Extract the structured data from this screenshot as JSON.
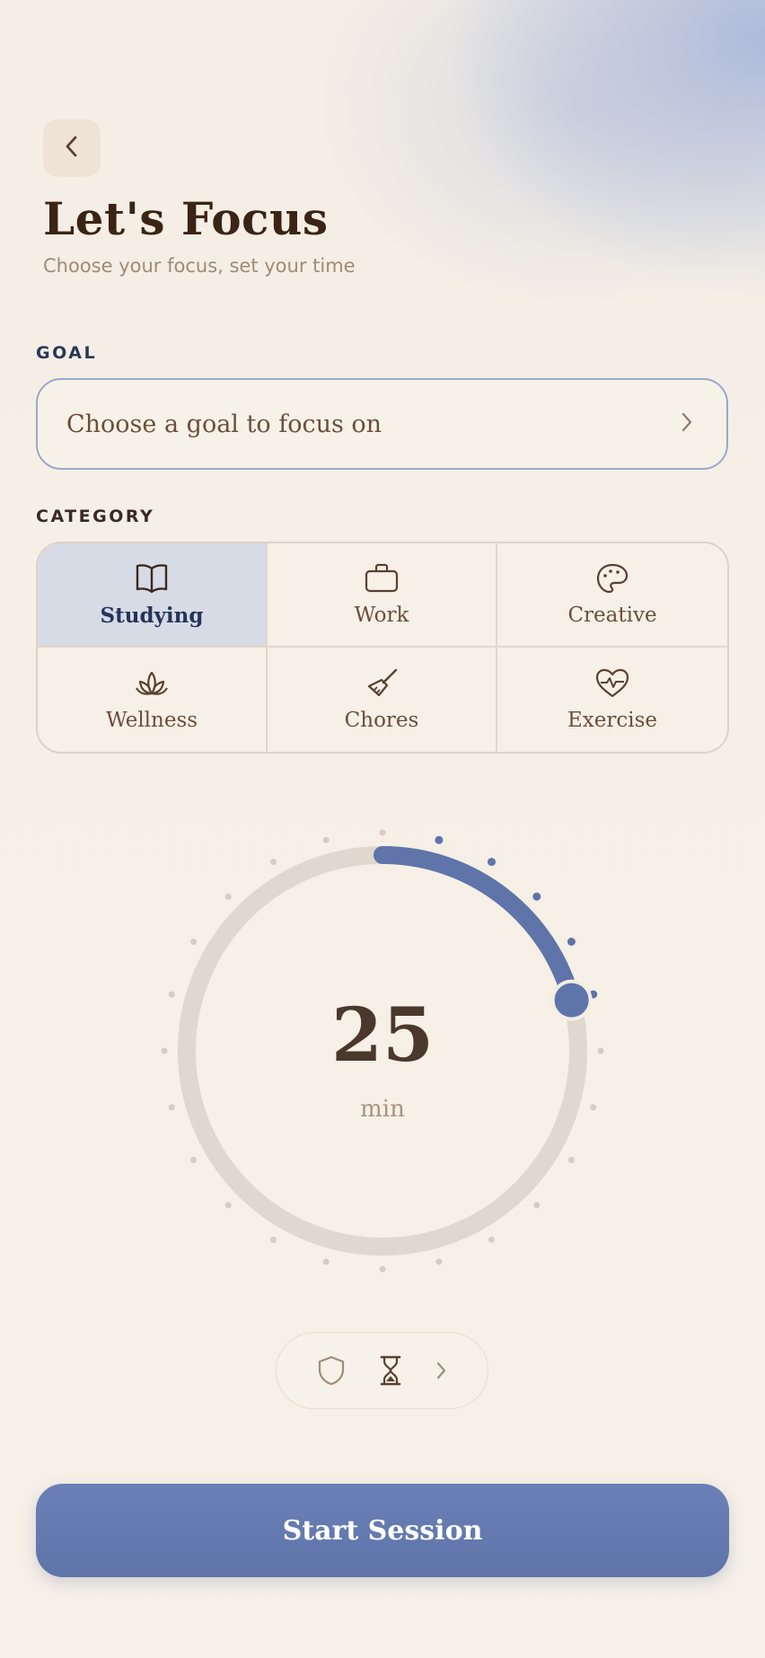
{
  "header": {
    "back_icon": "chevron-left-icon",
    "title": "Let's Focus",
    "subtitle": "Choose your focus, set your time"
  },
  "goal": {
    "section_label": "GOAL",
    "placeholder": "Choose a goal to focus on",
    "chevron_icon": "chevron-right-icon"
  },
  "category": {
    "section_label": "CATEGORY",
    "selected": "Studying",
    "items": [
      {
        "label": "Studying",
        "icon": "book-icon"
      },
      {
        "label": "Work",
        "icon": "briefcase-icon"
      },
      {
        "label": "Creative",
        "icon": "palette-icon"
      },
      {
        "label": "Wellness",
        "icon": "lotus-icon"
      },
      {
        "label": "Chores",
        "icon": "broom-icon"
      },
      {
        "label": "Exercise",
        "icon": "heart-pulse-icon"
      }
    ]
  },
  "timer": {
    "value": "25",
    "unit": "min",
    "minutes": 25,
    "max_minutes": 120,
    "tick_count": 24
  },
  "toolbar": {
    "icons": [
      "shield-icon",
      "hourglass-icon",
      "chevron-right-icon"
    ]
  },
  "actions": {
    "start_label": "Start Session"
  },
  "colors": {
    "accent": "#5f74a9",
    "background": "#f5efe6",
    "track": "#e0d8ce",
    "title": "#3a2415",
    "selected_bg": "#d7dbe6"
  }
}
